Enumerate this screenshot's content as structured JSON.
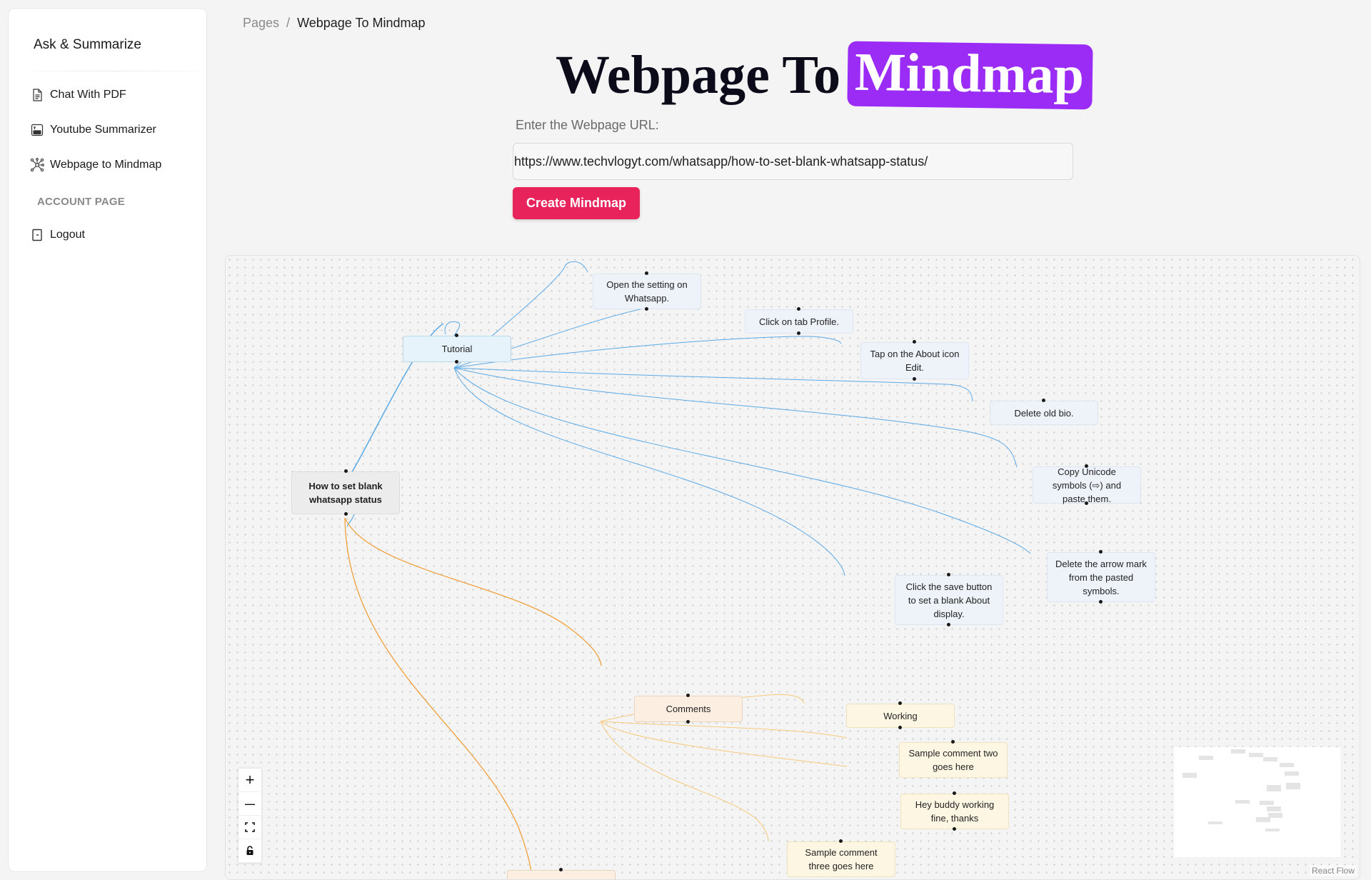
{
  "sidebar": {
    "brand": "Ask & Summarize",
    "items": [
      {
        "label": "Chat With PDF",
        "icon": "document-icon"
      },
      {
        "label": "Youtube Summarizer",
        "icon": "youtube-icon"
      },
      {
        "label": "Webpage to Mindmap",
        "icon": "network-icon"
      }
    ],
    "account_section_title": "ACCOUNT PAGE",
    "logout_label": "Logout"
  },
  "breadcrumb": {
    "parent": "Pages",
    "separator": "/",
    "current": "Webpage To Mindmap"
  },
  "title": {
    "prefix": "Webpage To",
    "highlight": "Mindmap"
  },
  "form": {
    "url_label": "Enter the Webpage URL:",
    "url_value": "https://www.techvlogyt.com/whatsapp/how-to-set-blank-whatsapp-status/",
    "submit_label": "Create Mindmap"
  },
  "mindmap": {
    "root": "How to set blank whatsapp status",
    "tutorial": {
      "label": "Tutorial",
      "steps": [
        "Open the setting on Whatsapp.",
        "Click on tab Profile.",
        "Tap on the About icon Edit.",
        "Delete old bio.",
        "Copy Unicode symbols (⇨) and paste them.",
        "Delete the arrow mark from the pasted symbols.",
        "Click the save button to set a blank About display."
      ]
    },
    "comments": {
      "label": "Comments",
      "items": [
        "Working",
        "Sample comment two goes here",
        "Hey buddy working fine, thanks",
        "Sample comment three goes here"
      ]
    }
  },
  "flow_controls": {
    "zoom_in": "+",
    "zoom_out": "—"
  },
  "attribution": "React Flow",
  "colors": {
    "accent_purple": "#9b2cf5",
    "button_pink": "#e8225a",
    "edge_blue": "#5aa9e6",
    "edge_orange": "#f0a03c"
  }
}
